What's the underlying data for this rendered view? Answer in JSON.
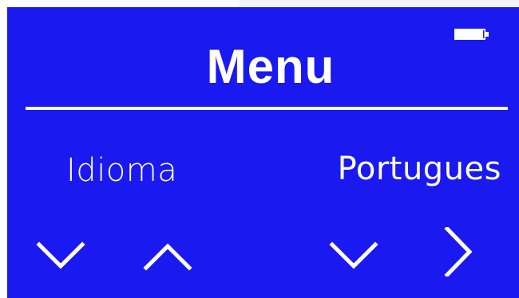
{
  "colors": {
    "screen_background": "#1a1af0",
    "foreground": "#ffffff"
  },
  "battery": {
    "icon": "battery-icon",
    "level": 0.9
  },
  "header": {
    "title": "Menu"
  },
  "setting": {
    "label": "Idioma",
    "value": "Portugues"
  },
  "controls": [
    {
      "name": "chevron-down-icon",
      "action": "next-item"
    },
    {
      "name": "chevron-up-icon",
      "action": "previous-item"
    },
    {
      "name": "chevron-down-icon",
      "action": "next-value"
    },
    {
      "name": "chevron-right-icon",
      "action": "enter"
    }
  ]
}
